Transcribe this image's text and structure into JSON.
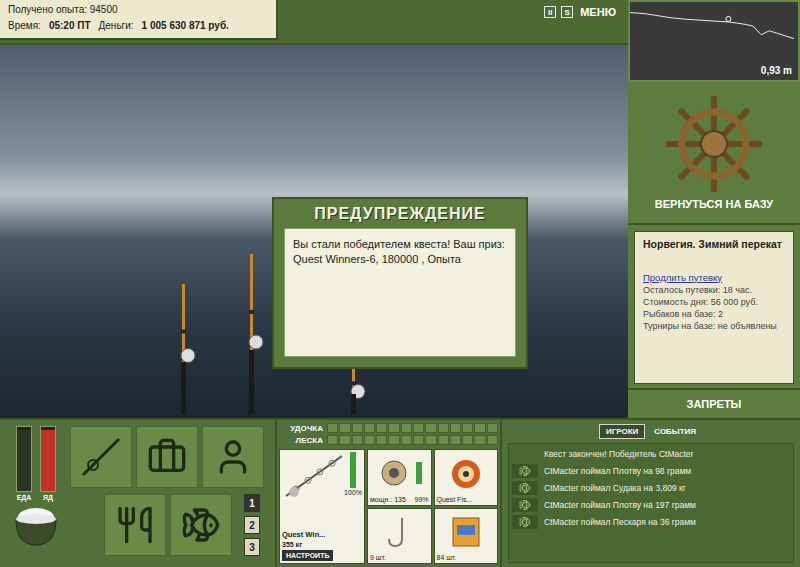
{
  "header": {
    "experience": "Получено опыта: 94500",
    "time_label": "Время:",
    "time": "05:20 ПТ",
    "money_label": "Деньги:",
    "money": "1 005 630 871 руб."
  },
  "top_controls": [
    {
      "label": "II",
      "kind": "pause"
    },
    {
      "label": "S",
      "kind": "speed"
    },
    {
      "label": "МЕНЮ",
      "kind": "menu"
    }
  ],
  "depth": {
    "reading": "0,93 m",
    "profile": [
      0.1,
      0.12,
      0.15,
      0.2,
      0.25,
      0.3,
      0.33,
      0.36,
      0.38,
      0.4,
      0.42,
      0.44,
      0.46,
      0.5,
      0.55,
      0.62,
      0.95,
      0.8,
      0.9,
      1.0,
      1.1
    ],
    "marker_index": 12
  },
  "dialog": {
    "title": "ПРЕДУПРЕЖДЕНИЕ",
    "message": "Вы стали победителем квеста! Ваш приз: Quest Winners-6, 180000 , Опыта"
  },
  "base_button": "ВЕРНУТЬСЯ НА БАЗУ",
  "location": {
    "title": "Норвегия. Зимний перекат",
    "link": "Продлить путевку",
    "stats": [
      "Осталось путевки: 18 час.",
      "Стоимость дня: 56 000 руб.",
      "Рыбаков на базе: 2",
      "Турниры на базе: не объявлены"
    ]
  },
  "bans_button": "ЗАПРЕТЫ",
  "gauges": [
    {
      "label": "ЕДА",
      "level": 0.95,
      "color": "#2c3320"
    },
    {
      "label": "ЯД",
      "level": 0.95,
      "color": "#c2302a"
    }
  ],
  "slots": [
    {
      "label": "1",
      "selected": true
    },
    {
      "label": "2",
      "selected": false
    },
    {
      "label": "3",
      "selected": false
    }
  ],
  "meters": [
    {
      "label": "УДОЧКА",
      "level": 0
    },
    {
      "label": "ЛЕСКА",
      "level": 0
    }
  ],
  "rod": {
    "name": "Quest Win...",
    "weight": "355 кг",
    "condition": "100%",
    "level": 1.0,
    "button": "НАСТРОИТЬ"
  },
  "tackle": [
    {
      "kind": "reel",
      "label": "мощн.: 135",
      "condition": "99%",
      "level": 0.99
    },
    {
      "kind": "line",
      "label": "Quest Fis..."
    },
    {
      "kind": "hook",
      "label": "9 шт."
    },
    {
      "kind": "bait",
      "label": "84 шт."
    }
  ],
  "tabs": [
    {
      "label": "ИГРОКИ",
      "selected": true
    },
    {
      "label": "СОБЫТИЯ",
      "selected": false
    }
  ],
  "events": [
    {
      "kind": "notice",
      "text": "Квест закончен! Победитель CtMacter"
    },
    {
      "kind": "catch",
      "text": "CtMacter поймал Плотву на 98 грамм"
    },
    {
      "kind": "catch",
      "text": "CtMacter поймал Судака на 3,809 кг"
    },
    {
      "kind": "catch",
      "text": "CtMacter поймал Плотву на 197 грамм"
    },
    {
      "kind": "catch",
      "text": "CtMacter поймал Пескаря на 36 грамм"
    }
  ]
}
